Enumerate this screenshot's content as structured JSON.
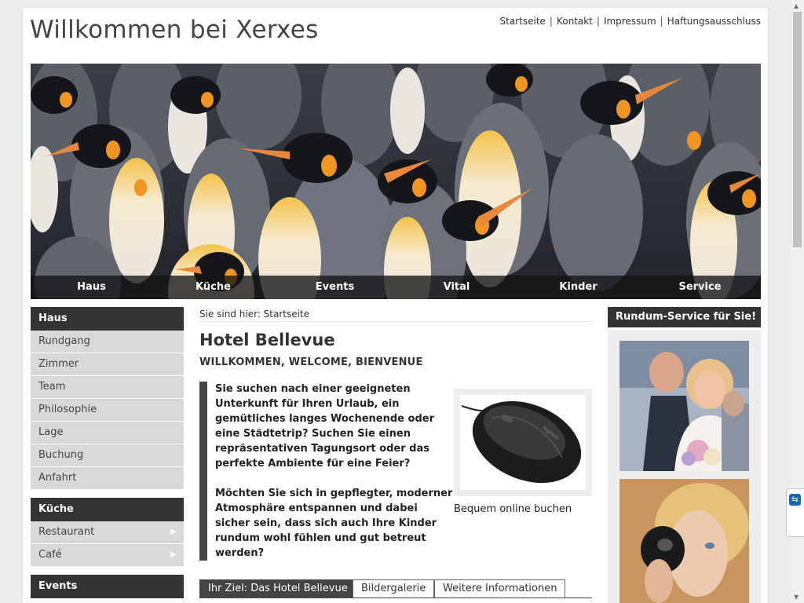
{
  "header": {
    "site_title": "Willkommen bei Xerxes",
    "top_nav": [
      "Startseite",
      "Kontakt",
      "Impressum",
      "Haftungsausschluss"
    ]
  },
  "main_nav": [
    "Haus",
    "Küche",
    "Events",
    "Vital",
    "Kinder",
    "Service"
  ],
  "sidebar": {
    "sections": [
      {
        "title": "Haus",
        "items": [
          "Rundgang",
          "Zimmer",
          "Team",
          "Philosophie",
          "Lage",
          "Buchung",
          "Anfahrt"
        ]
      },
      {
        "title": "Küche",
        "items": [
          "Restaurant",
          "Café"
        ]
      },
      {
        "title": "Events",
        "items": []
      }
    ],
    "submenu_arrow": "▶"
  },
  "content": {
    "breadcrumb": "Sie sind hier: Startseite",
    "title": "Hotel Bellevue",
    "subtitle": "WILLKOMMEN, WELCOME, BIENVENUE",
    "paragraphs": [
      "Sie suchen nach einer geeigneten Unterkunft für Ihren Urlaub, ein gemütliches langes Wochenende oder eine Städtetrip? Suchen Sie einen repräsentativen Tagungsort oder das perfekte Ambiente für eine Feier?",
      "Möchten Sie sich in gepflegter, moderner Atmosphäre entspannen und dabei sicher sein, dass sich auch Ihre Kinder rundum wohl fühlen und gut betreut werden?"
    ],
    "promo_caption": "Bequem online buchen",
    "tabs": [
      "Ihr Ziel: Das Hotel Bellevue",
      "Bildergalerie",
      "Weitere Informationen"
    ]
  },
  "right": {
    "title": "Rundum-Service für Sie!"
  },
  "colors": {
    "nav_dark": "#333333",
    "sidebar_item": "#d9d9d9",
    "page_bg": "#ececec"
  }
}
